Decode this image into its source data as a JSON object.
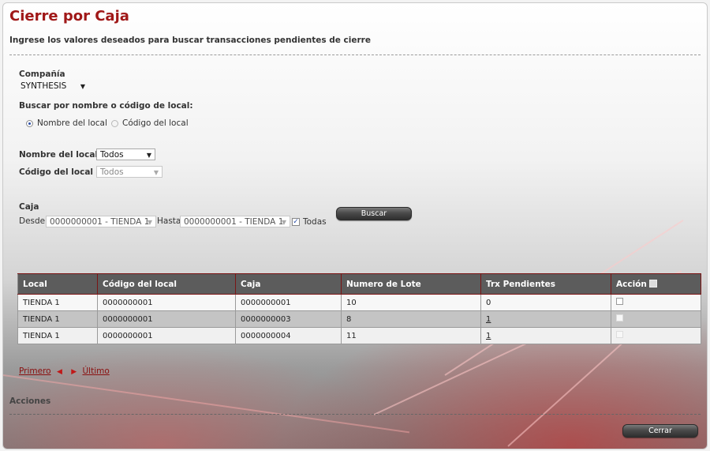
{
  "page": {
    "title": "Cierre por Caja",
    "subtitle": "Ingrese los valores deseados para buscar transacciones pendientes de cierre"
  },
  "compania": {
    "label": "Compañía",
    "value": "SYNTHESIS"
  },
  "buscar_por": {
    "label": "Buscar por nombre o código de local:",
    "options": [
      "Nombre del local",
      "Código del local"
    ],
    "selected": "Nombre del local"
  },
  "nombre_local": {
    "label": "Nombre del local",
    "value": "Todos"
  },
  "codigo_local": {
    "label": "Código del local",
    "value": "Todos"
  },
  "caja": {
    "label": "Caja",
    "desde_label": "Desde",
    "desde_value": "0000000001 - TIENDA 1",
    "hasta_label": "Hasta",
    "hasta_value": "0000000001 - TIENDA 1",
    "todas_label": "Todas",
    "todas_checked": true
  },
  "buttons": {
    "buscar": "Buscar",
    "cerrar": "Cerrar"
  },
  "table": {
    "headers": [
      "Local",
      "Código del local",
      "Caja",
      "Numero de Lote",
      "Trx Pendientes",
      "Acción"
    ],
    "rows": [
      {
        "local": "TIENDA 1",
        "codigo": "0000000001",
        "caja": "0000000001",
        "lote": "10",
        "trx": "0"
      },
      {
        "local": "TIENDA 1",
        "codigo": "0000000001",
        "caja": "0000000003",
        "lote": "8",
        "trx": "1"
      },
      {
        "local": "TIENDA 1",
        "codigo": "0000000001",
        "caja": "0000000004",
        "lote": "11",
        "trx": "1"
      }
    ]
  },
  "pager": {
    "first": "Primero",
    "last": "Último"
  },
  "acciones": {
    "label": "Acciones"
  },
  "colors": {
    "title": "#a01818",
    "header_bg": "#5c5c5c",
    "accent_red": "#c01818"
  }
}
